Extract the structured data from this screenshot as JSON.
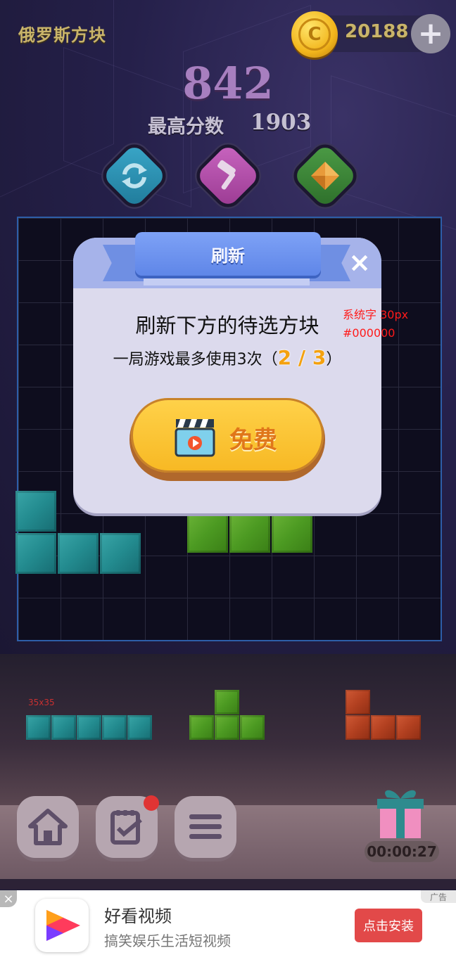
{
  "header": {
    "title": "俄罗斯方块",
    "coin_symbol": "C",
    "coins": "20188",
    "add_symbol": "+"
  },
  "score": {
    "current": "842",
    "best_label": "最高分数",
    "best_value": "1903"
  },
  "tools": [
    {
      "icon": "refresh-icon",
      "color": "#2a8fb0"
    },
    {
      "icon": "hammer-icon",
      "color": "#b14fa7"
    },
    {
      "icon": "bomb-diamond-icon",
      "color": "#3f8a3a"
    }
  ],
  "modal": {
    "title": "刷新",
    "close": "×",
    "message": "刷新下方的待选方块",
    "limit_prefix": "一局游戏最多使用3次（",
    "limit_count": "2 / 3",
    "limit_suffix": "）",
    "button_label": "免费"
  },
  "dev_notes": {
    "font_note": "系统字 30px",
    "color_note": "#000000",
    "size_note": "35x35"
  },
  "timer": "00:00:27",
  "ad": {
    "close": "×",
    "tag": "广告",
    "app_name": "好看视频",
    "description": "搞笑娱乐生活短视频",
    "install_label": "点击安装"
  },
  "colors": {
    "teal": "#238b8f",
    "green": "#4c9a22",
    "red": "#b24020",
    "accent_yellow": "#f7b823",
    "ribbon_blue": "#6f8fe3"
  }
}
